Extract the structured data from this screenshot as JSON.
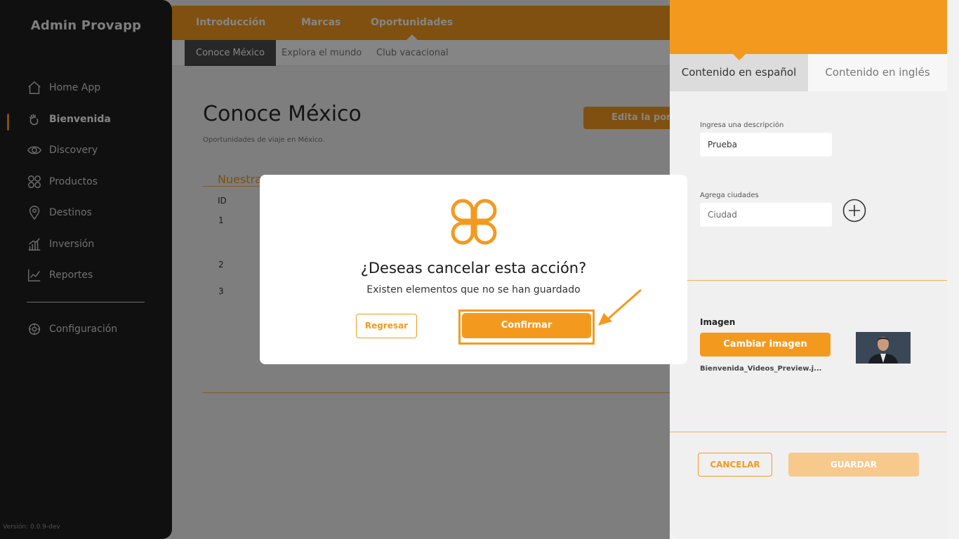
{
  "app": {
    "brand": "Admin Provapp",
    "version": "Versión: 0.0.9-dev"
  },
  "sidebar": {
    "items": [
      {
        "label": "Home App",
        "icon": "home-icon"
      },
      {
        "label": "Bienvenida",
        "icon": "hand-wave-icon",
        "active": true
      },
      {
        "label": "Discovery",
        "icon": "eye-icon"
      },
      {
        "label": "Productos",
        "icon": "grid-circles-icon"
      },
      {
        "label": "Destinos",
        "icon": "location-pin-icon"
      },
      {
        "label": "Inversión",
        "icon": "bar-chart-icon"
      },
      {
        "label": "Reportes",
        "icon": "line-chart-icon"
      }
    ],
    "settings": {
      "label": "Configuración",
      "icon": "gear-icon"
    }
  },
  "topnav": {
    "tabs": [
      "Introducción",
      "Marcas",
      "Oportunidades"
    ],
    "active": "Oportunidades"
  },
  "subnav": {
    "tabs": [
      "Conoce México",
      "Explora el mundo",
      "Club vacacional"
    ],
    "active": "Conoce México"
  },
  "main": {
    "title": "Conoce México",
    "subtitle": "Oportunidades de viaje en México.",
    "edit_button": "Edita la porta",
    "section_title": "Nuestra",
    "table": {
      "col_id": "ID",
      "rows": [
        "1",
        "2",
        "3"
      ]
    }
  },
  "panel": {
    "tabs": [
      "Contenido en español",
      "Contenido en inglés"
    ],
    "description_label": "Ingresa una descripción",
    "description_value": "Prueba",
    "cities_label": "Agrega ciudades",
    "cities_placeholder": "Ciudad",
    "image_label": "Imagen",
    "change_image": "Cambiar imagen",
    "image_file": "Bienvenida_Videos_Preview.j...",
    "cancel": "CANCELAR",
    "save": "GUARDAR"
  },
  "modal": {
    "title": "¿Deseas cancelar esta acción?",
    "text": "Existen elementos que no se han guardado",
    "back": "Regresar",
    "confirm": "Confirmar"
  },
  "colors": {
    "accent": "#f39a1e",
    "sidebar": "#1f1f1f"
  }
}
